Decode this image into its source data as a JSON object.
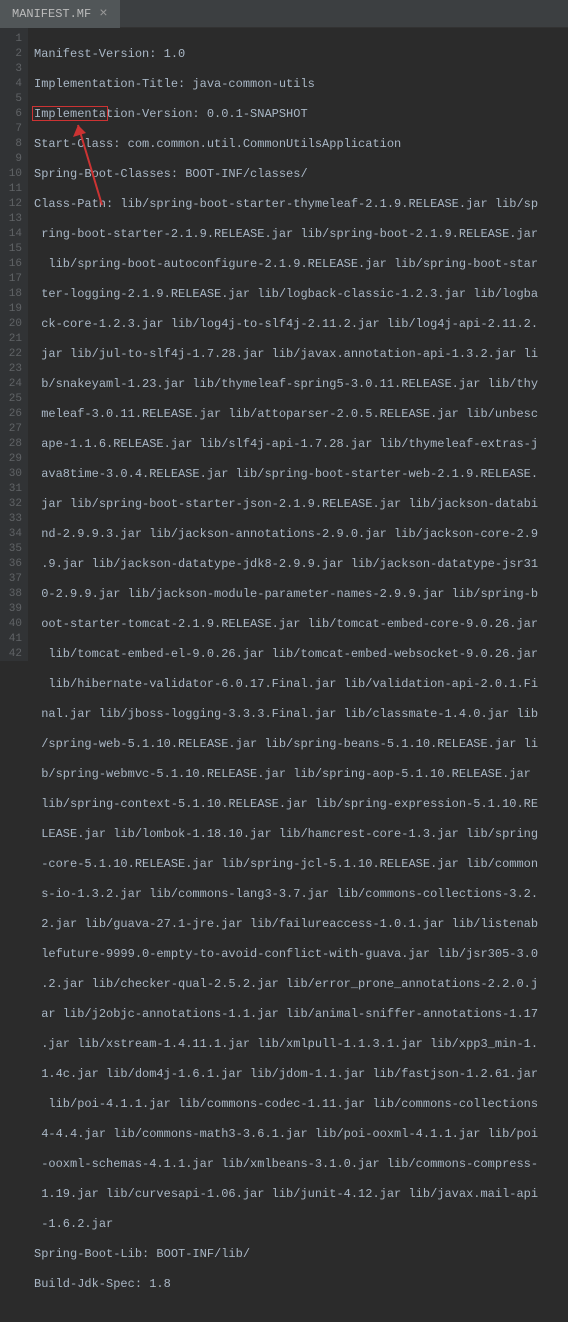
{
  "tab": {
    "title": "MANIFEST.MF"
  },
  "lines": {
    "l1": "Manifest-Version: 1.0",
    "l2": "Implementation-Title: java-common-utils",
    "l3": "Implementation-Version: 0.0.1-SNAPSHOT",
    "l4": "Start-Class: com.common.util.CommonUtilsApplication",
    "l5": "Spring-Boot-Classes: BOOT-INF/classes/",
    "l6": "Class-Path: lib/spring-boot-starter-thymeleaf-2.1.9.RELEASE.jar lib/sp",
    "l7": " ring-boot-starter-2.1.9.RELEASE.jar lib/spring-boot-2.1.9.RELEASE.jar",
    "l8": "  lib/spring-boot-autoconfigure-2.1.9.RELEASE.jar lib/spring-boot-star",
    "l9": " ter-logging-2.1.9.RELEASE.jar lib/logback-classic-1.2.3.jar lib/logba",
    "l10": " ck-core-1.2.3.jar lib/log4j-to-slf4j-2.11.2.jar lib/log4j-api-2.11.2.",
    "l11": " jar lib/jul-to-slf4j-1.7.28.jar lib/javax.annotation-api-1.3.2.jar li",
    "l12": " b/snakeyaml-1.23.jar lib/thymeleaf-spring5-3.0.11.RELEASE.jar lib/thy",
    "l13": " meleaf-3.0.11.RELEASE.jar lib/attoparser-2.0.5.RELEASE.jar lib/unbesc",
    "l14": " ape-1.1.6.RELEASE.jar lib/slf4j-api-1.7.28.jar lib/thymeleaf-extras-j",
    "l15": " ava8time-3.0.4.RELEASE.jar lib/spring-boot-starter-web-2.1.9.RELEASE.",
    "l16": " jar lib/spring-boot-starter-json-2.1.9.RELEASE.jar lib/jackson-databi",
    "l17": " nd-2.9.9.3.jar lib/jackson-annotations-2.9.0.jar lib/jackson-core-2.9",
    "l18": " .9.jar lib/jackson-datatype-jdk8-2.9.9.jar lib/jackson-datatype-jsr31",
    "l19": " 0-2.9.9.jar lib/jackson-module-parameter-names-2.9.9.jar lib/spring-b",
    "l20": " oot-starter-tomcat-2.1.9.RELEASE.jar lib/tomcat-embed-core-9.0.26.jar",
    "l21": "  lib/tomcat-embed-el-9.0.26.jar lib/tomcat-embed-websocket-9.0.26.jar",
    "l22": "  lib/hibernate-validator-6.0.17.Final.jar lib/validation-api-2.0.1.Fi",
    "l23": " nal.jar lib/jboss-logging-3.3.3.Final.jar lib/classmate-1.4.0.jar lib",
    "l24": " /spring-web-5.1.10.RELEASE.jar lib/spring-beans-5.1.10.RELEASE.jar li",
    "l25": " b/spring-webmvc-5.1.10.RELEASE.jar lib/spring-aop-5.1.10.RELEASE.jar ",
    "l26": " lib/spring-context-5.1.10.RELEASE.jar lib/spring-expression-5.1.10.RE",
    "l27": " LEASE.jar lib/lombok-1.18.10.jar lib/hamcrest-core-1.3.jar lib/spring",
    "l28": " -core-5.1.10.RELEASE.jar lib/spring-jcl-5.1.10.RELEASE.jar lib/common",
    "l29": " s-io-1.3.2.jar lib/commons-lang3-3.7.jar lib/commons-collections-3.2.",
    "l30": " 2.jar lib/guava-27.1-jre.jar lib/failureaccess-1.0.1.jar lib/listenab",
    "l31": " lefuture-9999.0-empty-to-avoid-conflict-with-guava.jar lib/jsr305-3.0",
    "l32": " .2.jar lib/checker-qual-2.5.2.jar lib/error_prone_annotations-2.2.0.j",
    "l33": " ar lib/j2objc-annotations-1.1.jar lib/animal-sniffer-annotations-1.17",
    "l34": " .jar lib/xstream-1.4.11.1.jar lib/xmlpull-1.1.3.1.jar lib/xpp3_min-1.",
    "l35": " 1.4c.jar lib/dom4j-1.6.1.jar lib/jdom-1.1.jar lib/fastjson-1.2.61.jar",
    "l36": "  lib/poi-4.1.1.jar lib/commons-codec-1.11.jar lib/commons-collections",
    "l37": " 4-4.4.jar lib/commons-math3-3.6.1.jar lib/poi-ooxml-4.1.1.jar lib/poi",
    "l38": " -ooxml-schemas-4.1.1.jar lib/xmlbeans-3.1.0.jar lib/commons-compress-",
    "l39": " 1.19.jar lib/curvesapi-1.06.jar lib/junit-4.12.jar lib/javax.mail-api",
    "l40": " -1.6.2.jar",
    "l41": "Spring-Boot-Lib: BOOT-INF/lib/",
    "l42": "Build-Jdk-Spec: 1.8"
  },
  "gutter": [
    "1",
    "2",
    "3",
    "4",
    "5",
    "6",
    "7",
    "8",
    "9",
    "10",
    "11",
    "12",
    "13",
    "14",
    "15",
    "16",
    "17",
    "18",
    "19",
    "20",
    "21",
    "22",
    "23",
    "24",
    "25",
    "26",
    "27",
    "28",
    "29",
    "30",
    "31",
    "32",
    "33",
    "34",
    "35",
    "36",
    "37",
    "38",
    "39",
    "40",
    "41",
    "42"
  ]
}
